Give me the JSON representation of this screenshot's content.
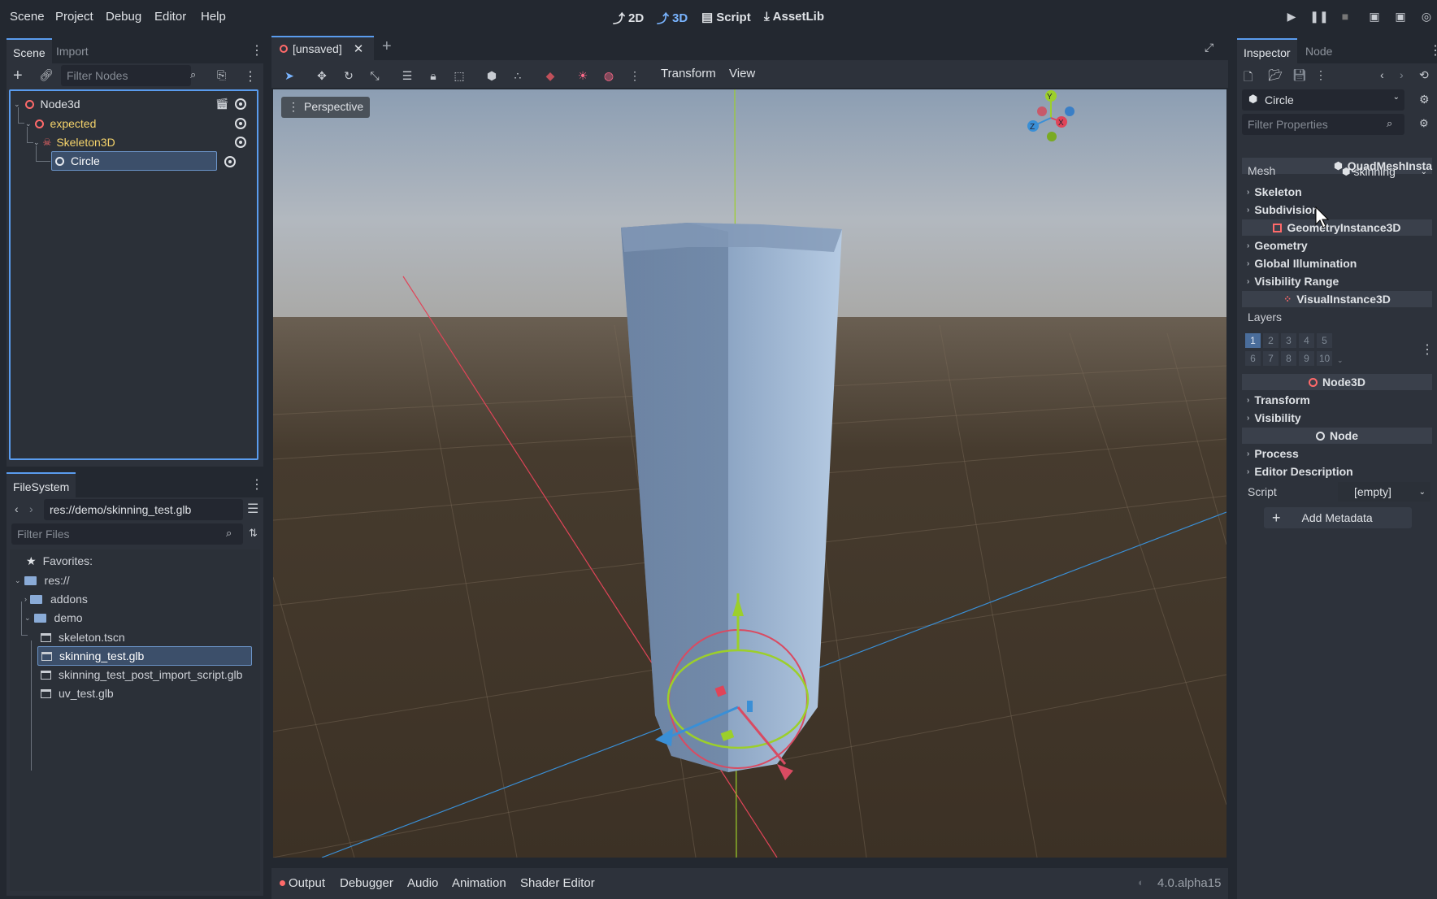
{
  "menu": [
    "Scene",
    "Project",
    "Debug",
    "Editor",
    "Help"
  ],
  "workspaces": [
    {
      "label": "2D",
      "icon": "2d-icon",
      "active": false
    },
    {
      "label": "3D",
      "icon": "3d-icon",
      "active": true
    },
    {
      "label": "Script",
      "icon": "script-icon",
      "active": false
    },
    {
      "label": "AssetLib",
      "icon": "assetlib-icon",
      "active": false
    }
  ],
  "scene_dock": {
    "tabs": [
      "Scene",
      "Import"
    ],
    "filter_placeholder": "Filter Nodes",
    "tree": [
      {
        "label": "Node3d",
        "icon": "node3d-icon",
        "color": "#dfe2e6"
      },
      {
        "label": "expected",
        "icon": "node3d-icon",
        "color": "#f5d36b"
      },
      {
        "label": "Skeleton3D",
        "icon": "skeleton-icon",
        "color": "#f5d36b"
      },
      {
        "label": "Circle",
        "icon": "mesh-instance-icon",
        "color": "#dfe2e6",
        "selected": true
      }
    ]
  },
  "filesystem": {
    "tab": "FileSystem",
    "path": "res://demo/skinning_test.glb",
    "filter_placeholder": "Filter Files",
    "items": [
      {
        "label": "Favorites:",
        "icon": "star-icon"
      },
      {
        "label": "res://",
        "icon": "folder-icon"
      },
      {
        "label": "addons",
        "icon": "folder-icon"
      },
      {
        "label": "demo",
        "icon": "folder-icon"
      },
      {
        "label": "skeleton.tscn",
        "icon": "scene-file-icon"
      },
      {
        "label": "skinning_test.glb",
        "icon": "scene-file-icon",
        "selected": true
      },
      {
        "label": "skinning_test_post_import_script.glb",
        "icon": "scene-file-icon"
      },
      {
        "label": "uv_test.glb",
        "icon": "scene-file-icon"
      }
    ]
  },
  "editor_tab": "[unsaved]",
  "viewport_toolbar": {
    "transform": "Transform",
    "view": "View"
  },
  "viewport": {
    "perspective_label": "Perspective",
    "gizmo": {
      "x": "X",
      "y": "Y",
      "z": "Z"
    }
  },
  "bottom_tabs": [
    "Output",
    "Debugger",
    "Audio",
    "Animation",
    "Shader Editor"
  ],
  "version": "4.0.alpha15",
  "inspector": {
    "tabs": [
      "Inspector",
      "Node"
    ],
    "object": "Circle",
    "filter_placeholder": "Filter Properties",
    "class_quad": "QuadMeshInsta",
    "mesh_label": "Mesh",
    "mesh_value": "skinning",
    "sections_a": [
      "Skeleton",
      "Subdivision"
    ],
    "class_geom": "GeometryInstance3D",
    "sections_b": [
      "Geometry",
      "Global Illumination",
      "Visibility Range"
    ],
    "class_visual": "VisualInstance3D",
    "layers_label": "Layers",
    "layers": [
      "1",
      "2",
      "3",
      "4",
      "5",
      "6",
      "7",
      "8",
      "9",
      "10"
    ],
    "class_node3d": "Node3D",
    "sections_c": [
      "Transform",
      "Visibility"
    ],
    "class_node": "Node",
    "sections_d": [
      "Process",
      "Editor Description"
    ],
    "script_label": "Script",
    "script_value": "[empty]",
    "add_metadata": "Add Metadata"
  }
}
